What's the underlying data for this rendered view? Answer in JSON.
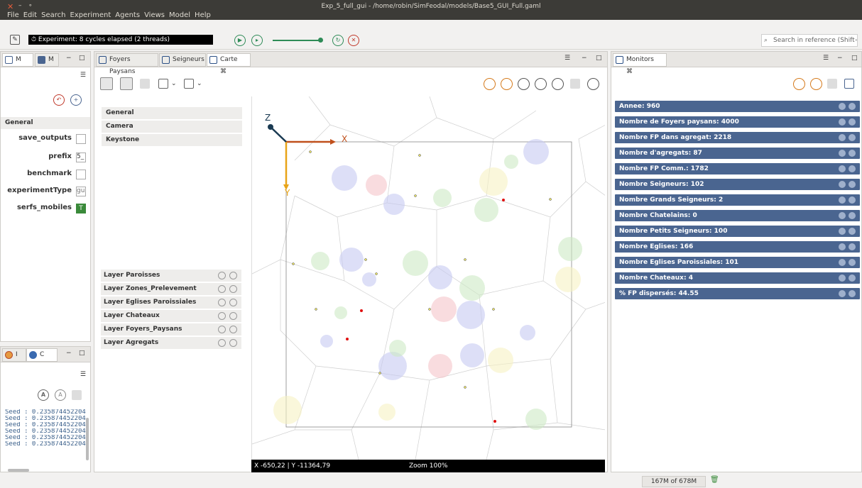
{
  "window": {
    "title": "Exp_5_full_gui - /home/robin/SimFeodal/models/Base5_GUI_Full.gaml"
  },
  "menu": [
    "File",
    "Edit",
    "Search",
    "Experiment",
    "Agents",
    "Views",
    "Model",
    "Help"
  ],
  "toolbar": {
    "experiment_status": "Experiment: 8 cycles elapsed (2 threads)",
    "search_placeholder": "Search in reference (Shift+C"
  },
  "params_panel": {
    "tabs": [
      "M",
      "M"
    ],
    "section": "General",
    "params": [
      {
        "label": "save_outputs",
        "value": ""
      },
      {
        "label": "prefix",
        "value": "5_"
      },
      {
        "label": "benchmark",
        "value": ""
      },
      {
        "label": "experimentType",
        "value": "gu"
      },
      {
        "label": "serfs_mobiles",
        "value": "T"
      }
    ]
  },
  "console_panel": {
    "tabs": [
      "I",
      "C"
    ],
    "lines": [
      "Seed : 0.235874452204",
      "Seed : 0.235874452204",
      "Seed : 0.235874452204",
      "Seed : 0.235874452204",
      "Seed : 0.235874452204",
      "Seed : 0.235874452204"
    ]
  },
  "display_panel": {
    "tabs": [
      "Foyers Paysans",
      "Seigneurs",
      "Carte"
    ],
    "sections": [
      "General",
      "Camera",
      "Keystone"
    ],
    "layers": [
      "Layer Paroisses",
      "Layer Zones_Prelevement",
      "Layer Eglises Paroissiales",
      "Layer Chateaux",
      "Layer Foyers_Paysans",
      "Layer Agregats"
    ],
    "axes": {
      "x": "X",
      "y": "Y",
      "z": "Z"
    },
    "coords": "X -650,22 | Y -11364,79",
    "zoom": "Zoom 100%"
  },
  "monitors_panel": {
    "tab": "Monitors",
    "monitors": [
      {
        "label": "Annee:",
        "value": "960"
      },
      {
        "label": "Nombre de Foyers paysans:",
        "value": "4000"
      },
      {
        "label": "Nombre FP dans agregat:",
        "value": "2218"
      },
      {
        "label": "Nombre d'agregats:",
        "value": "87"
      },
      {
        "label": "Nombre FP Comm.:",
        "value": "1782"
      },
      {
        "label": "Nombre Seigneurs:",
        "value": "102"
      },
      {
        "label": "Nombre Grands Seigneurs:",
        "value": "2"
      },
      {
        "label": "Nombre Chatelains:",
        "value": "0"
      },
      {
        "label": "Nombre Petits Seigneurs:",
        "value": "100"
      },
      {
        "label": "Nombre Eglises:",
        "value": "166"
      },
      {
        "label": "Nombre Eglises Paroissiales:",
        "value": "101"
      },
      {
        "label": "Nombre Chateaux:",
        "value": "4"
      },
      {
        "label": "% FP dispersés:",
        "value": "44.55"
      }
    ]
  },
  "status": {
    "memory": "167M of 678M"
  },
  "colors": {
    "monitor_bg": "#4a6590",
    "run_green": "#2e8b57",
    "close_red": "#c0392b",
    "map_bg": "#ffffff"
  }
}
